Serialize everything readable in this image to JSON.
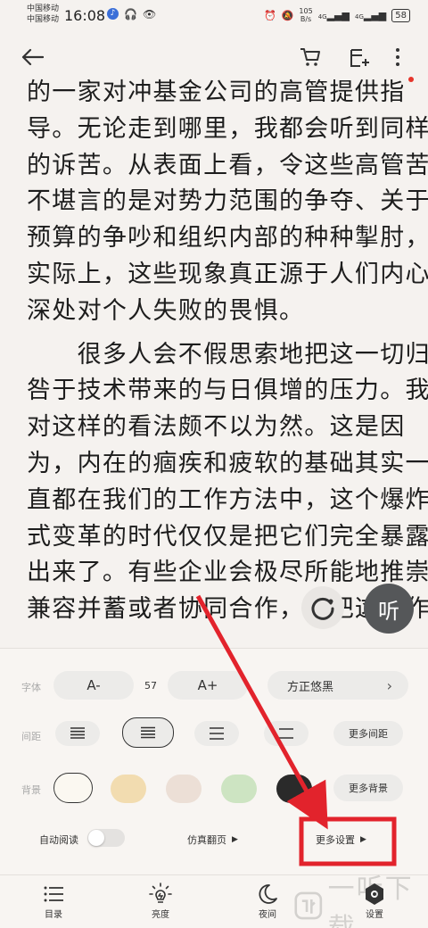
{
  "status": {
    "carrier1": "中国移动",
    "carrier2": "中国移动",
    "time": "16:08",
    "speed_value": "105",
    "speed_unit": "B/s",
    "signal1": "4G",
    "signal2": "4G",
    "battery": "58"
  },
  "content": {
    "lines": [
      "的一家对冲基金公司的高管提供指",
      "导。无论走到哪里，我都会听到同样",
      "的诉苦。从表面上看，令这些高管苦",
      "不堪言的是对势力范围的争夺、关于",
      "预算的争吵和组织内部的种种掣肘，",
      "实际上，这些现象真正源于人们内心",
      "深处对个人失败的畏惧。",
      "　　很多人会不假思索地把这一切归",
      "咎于技术带来的与日俱增的压力。我",
      "对这样的看法颇不以为然。这是因",
      "为，内在的痼疾和疲软的基础其实一",
      "直都在我们的工作方法中，这个爆炸",
      "式变革的时代仅仅是把它们完全暴露",
      "出来了。有些企业会极尽所能地推崇",
      "兼容并蓄或者协同合作，并把这些作"
    ]
  },
  "floating": {
    "listen_label": "听"
  },
  "settings": {
    "font_label": "字体",
    "font_decrease": "A-",
    "font_size": "57",
    "font_increase": "A+",
    "font_name": "方正悠黑",
    "spacing_label": "间距",
    "more_spacing": "更多间距",
    "background_label": "背景",
    "more_background": "更多背景",
    "auto_read": "自动阅读",
    "page_turn": "仿真翻页",
    "more_settings": "更多设置",
    "backgrounds": [
      "#fbf8f1",
      "#f2dcb0",
      "#ecdfd6",
      "#cde4c2",
      "#2a2a2a"
    ]
  },
  "nav": {
    "toc": "目录",
    "brightness": "亮度",
    "night": "夜间",
    "settings": "设置"
  },
  "watermark": {
    "text": "一听下载"
  },
  "annotation_color": "#e2232c"
}
